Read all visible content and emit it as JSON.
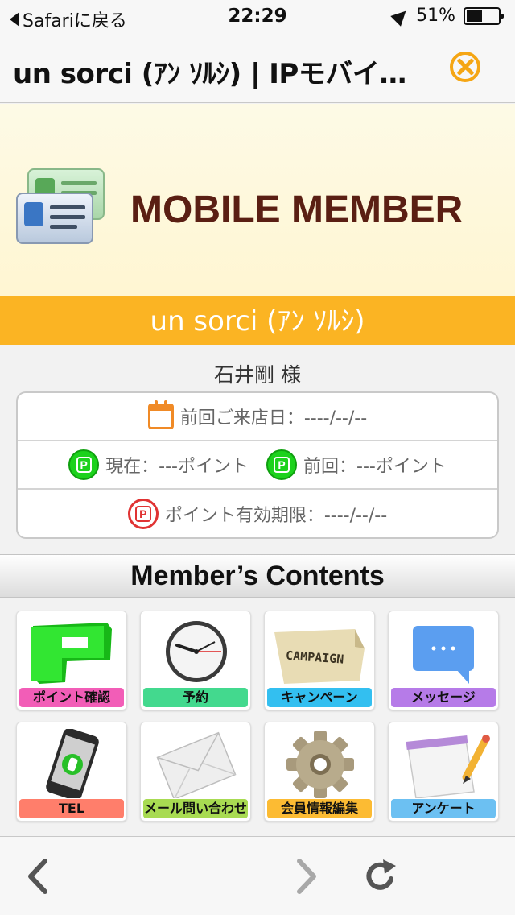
{
  "status_bar": {
    "back_label": "Safariに戻る",
    "time": "22:29",
    "battery": "51%",
    "battery_level": 0.51
  },
  "title_bar": {
    "title": "un sorci (ｱﾝ ｿﾙｼ) | IPモバイ…"
  },
  "banner": {
    "heading": "MOBILE MEMBER",
    "icon": "member-card-icon"
  },
  "store": {
    "name": "un sorci (ｱﾝ ｿﾙｼ)"
  },
  "member": {
    "name": "石井剛 様",
    "last_visit": "前回ご来店日：----/--/--",
    "current_points": "現在：---ポイント",
    "previous_points": "前回：---ポイント",
    "point_expiry": "ポイント有効期限：----/--/--",
    "point_icon_letter": "P"
  },
  "contents": {
    "heading": "Member’s Contents",
    "items": [
      {
        "label": "ポイント確認",
        "icon": "point-icon",
        "color": "#f25db7"
      },
      {
        "label": "予約",
        "icon": "clock-icon",
        "color": "#43d98e"
      },
      {
        "label": "キャンペーン",
        "icon": "campaign-icon",
        "color": "#33bff0",
        "art_text": "CAMPAIGN"
      },
      {
        "label": "メッセージ",
        "icon": "message-icon",
        "color": "#b67be8"
      },
      {
        "label": "TEL",
        "icon": "phone-icon",
        "color": "#ff7e6b"
      },
      {
        "label": "メール問い合わせ",
        "icon": "mail-icon",
        "color": "#a8db52"
      },
      {
        "label": "会員情報編集",
        "icon": "gear-icon",
        "color": "#fcbb33"
      },
      {
        "label": "アンケート",
        "icon": "survey-icon",
        "color": "#6cc0f2"
      }
    ]
  },
  "toolbar": {
    "back_icon": "chevron-left-icon",
    "forward_icon": "chevron-right-icon",
    "reload_icon": "reload-icon"
  }
}
